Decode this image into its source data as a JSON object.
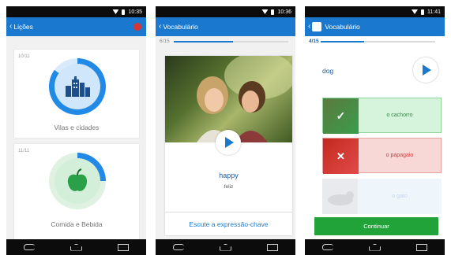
{
  "status": {
    "time1": "10:35",
    "time2": "10:36",
    "time3": "11:41"
  },
  "screen1": {
    "title": "Lições",
    "lessons": [
      {
        "count": "10/11",
        "title": "Vilas e cidades",
        "progress": 0.85
      },
      {
        "count": "11/11",
        "title": "Comida e Bebida",
        "progress": 0.25
      }
    ]
  },
  "screen2": {
    "title": "Vocabulário",
    "progress_label": "6/15",
    "progress": 0.52,
    "word": "happy",
    "translation": "feliz",
    "listen_label": "Escute a expressão-chave"
  },
  "screen3": {
    "title": "Vocabulário",
    "progress_label": "4/15",
    "progress": 0.38,
    "word": "dog",
    "options": [
      {
        "label": "o cachorro",
        "state": "correct"
      },
      {
        "label": "o papagaio",
        "state": "wrong"
      },
      {
        "label": "o gato",
        "state": "neutral"
      }
    ],
    "continue_label": "Continuar"
  },
  "colors": {
    "appbar": "#1a79cf",
    "correct": "#3a9c4c",
    "wrong": "#e24a4a",
    "continue": "#21a339"
  }
}
